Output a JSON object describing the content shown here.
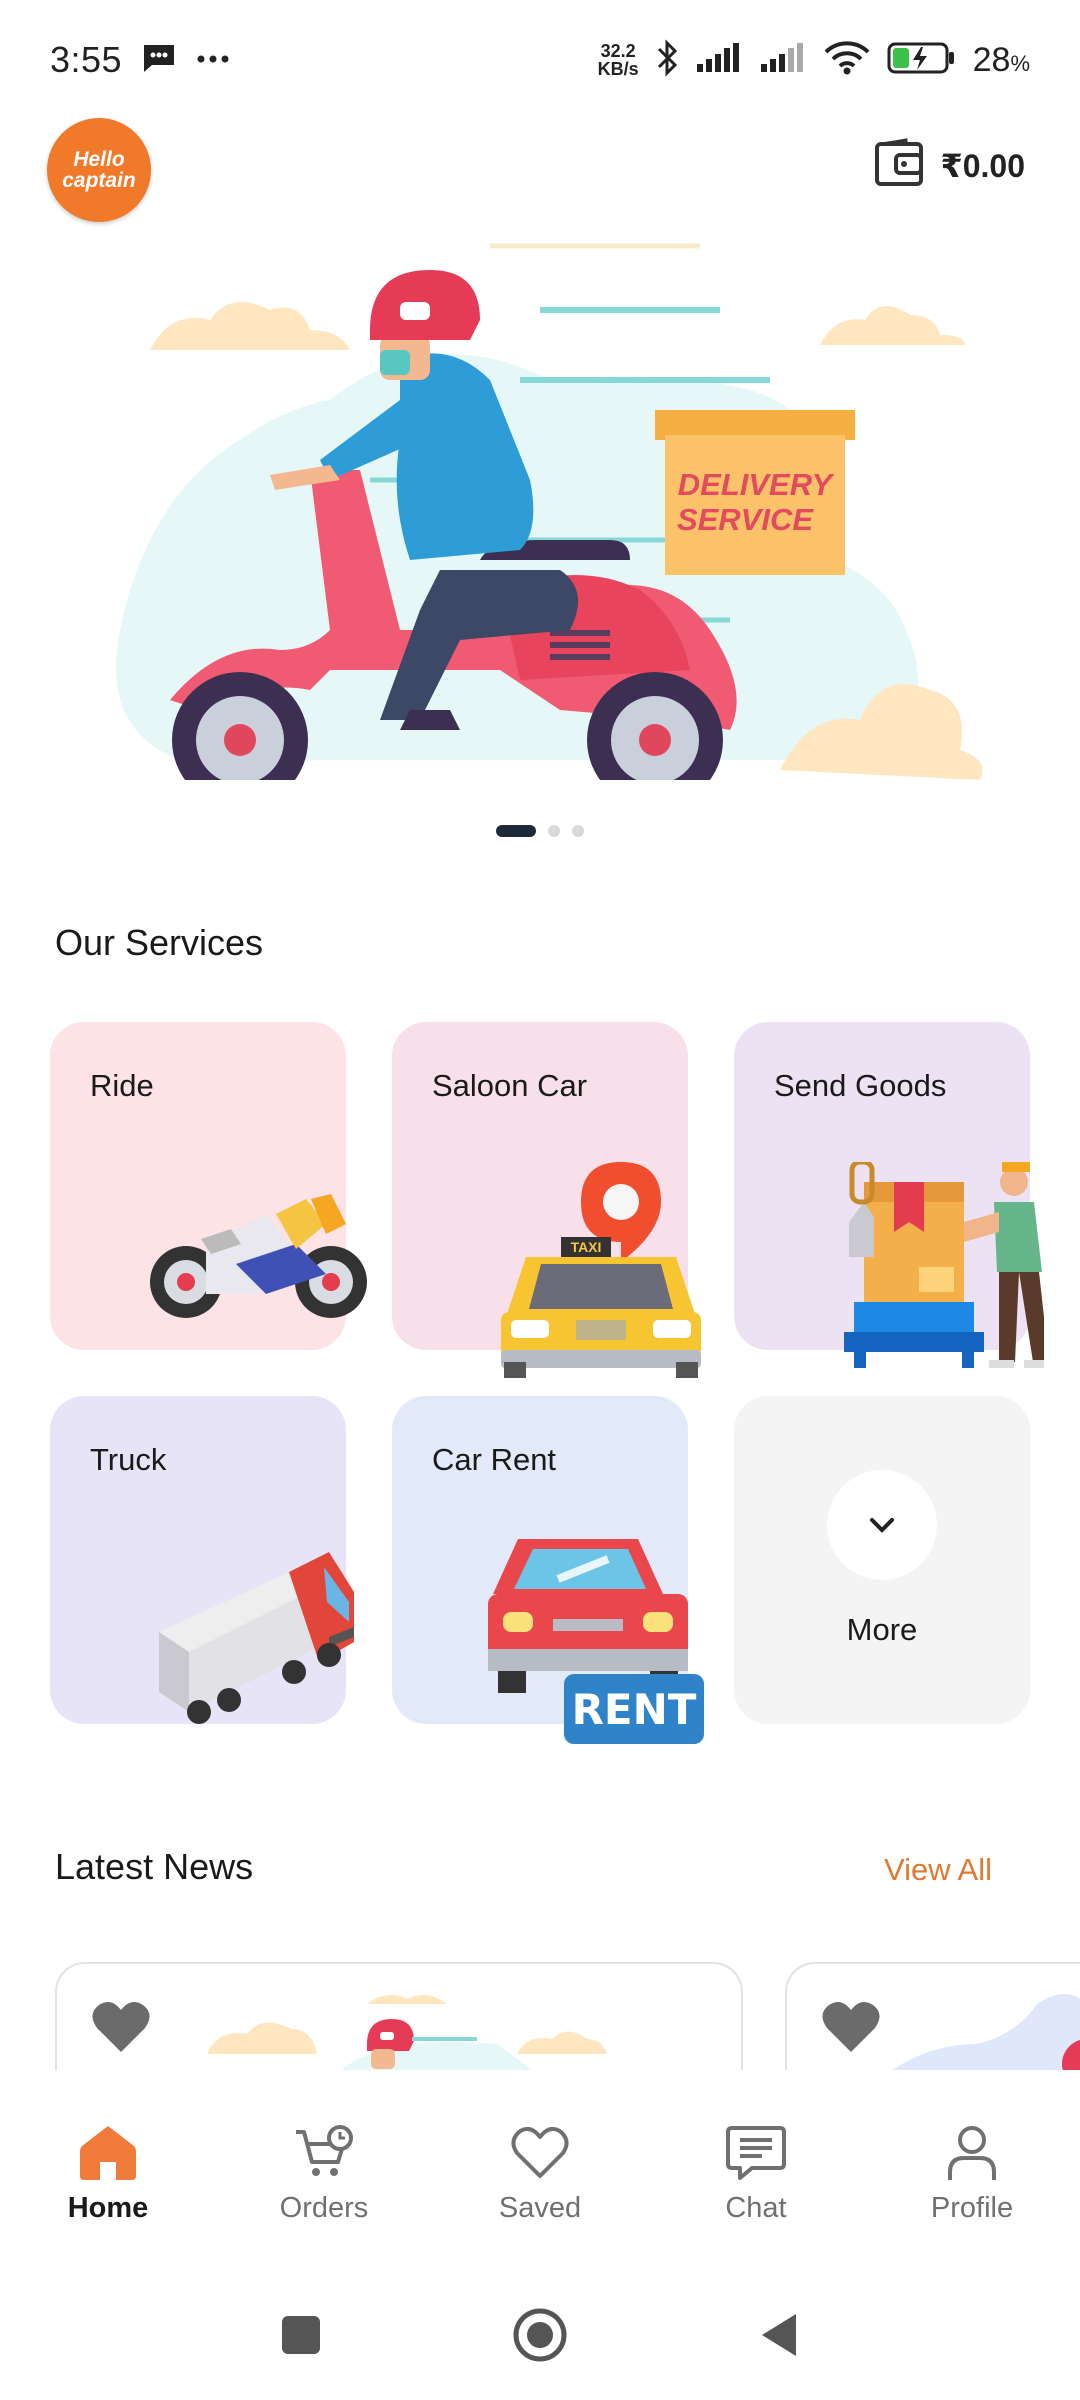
{
  "status_bar": {
    "time": "3:55",
    "speed_value": "32.2",
    "speed_unit": "KB/s",
    "battery": "28",
    "battery_unit": "%"
  },
  "header": {
    "logo_text_line1": "Hello",
    "logo_text_line2": "captain",
    "wallet_balance": "₹0.00"
  },
  "banner": {
    "box_line1": "DELIVERY",
    "box_line2": "SERVICE",
    "slide_count": 3,
    "active_slide": 1
  },
  "services": {
    "title": "Our Services",
    "items": [
      {
        "label": "Ride",
        "color": "#fde2e6"
      },
      {
        "label": "Saloon Car",
        "color": "#f8e0eb"
      },
      {
        "label": "Send Goods",
        "color": "#ede2f4"
      },
      {
        "label": "Truck",
        "color": "#e6e4f6"
      },
      {
        "label": "Car Rent",
        "color": "#e2e9f8"
      },
      {
        "label": "More",
        "color": "#f4f4f4"
      }
    ],
    "taxi_sign": "TAXI",
    "rent_sign": "RENT"
  },
  "news": {
    "title": "Latest News",
    "view_all": "View All"
  },
  "bottom_nav": {
    "items": [
      {
        "label": "Home",
        "icon": "home-icon",
        "active": true
      },
      {
        "label": "Orders",
        "icon": "cart-icon",
        "active": false
      },
      {
        "label": "Saved",
        "icon": "heart-icon",
        "active": false
      },
      {
        "label": "Chat",
        "icon": "chat-icon",
        "active": false
      },
      {
        "label": "Profile",
        "icon": "profile-icon",
        "active": false
      }
    ]
  },
  "colors": {
    "accent": "#e07a32",
    "home_active": "#f07a3a"
  }
}
